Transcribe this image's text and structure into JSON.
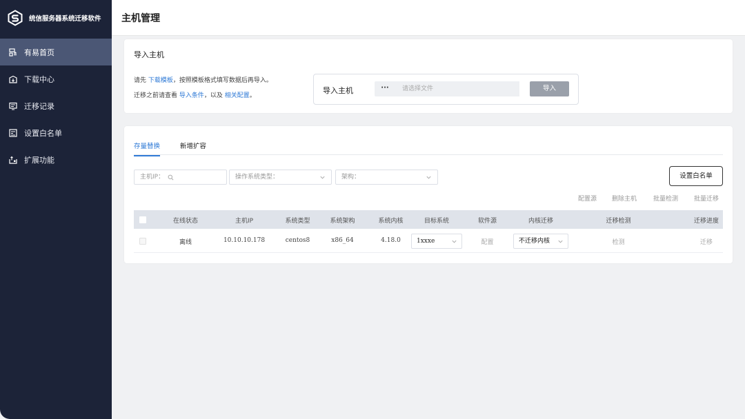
{
  "app": {
    "title": "统信服务器系统迁移软件"
  },
  "sidebar": {
    "items": [
      {
        "label": "有易首页",
        "icon": "home-icon",
        "active": true
      },
      {
        "label": "下载中心",
        "icon": "download-icon",
        "active": false
      },
      {
        "label": "迁移记录",
        "icon": "record-icon",
        "active": false
      },
      {
        "label": "设置白名单",
        "icon": "whitelist-icon",
        "active": false
      },
      {
        "label": "扩展功能",
        "icon": "extension-icon",
        "active": false
      }
    ]
  },
  "header": {
    "title": "主机管理"
  },
  "import_card": {
    "title": "导入主机",
    "hint1_prefix": "请先 ",
    "hint1_link": "下载模板",
    "hint1_suffix": "，按照模板格式填写数据后再导入。",
    "hint2_prefix": "迁移之前请查看 ",
    "hint2_link1": "导入条件",
    "hint2_mid": "，以及 ",
    "hint2_link2": "相关配置",
    "hint2_suffix": "。",
    "field_label": "导入主机",
    "browse_label": "···",
    "file_placeholder": "请选择文件",
    "import_button": "导入"
  },
  "list_card": {
    "tabs": [
      {
        "label": "存量替换",
        "active": true
      },
      {
        "label": "新增扩容",
        "active": false
      }
    ],
    "filters": {
      "ip_placeholder": "主机IP：",
      "os_placeholder": "操作系统类型：",
      "arch_placeholder": "架构："
    },
    "whitelist_button": "设置白名单",
    "actions": [
      "配置源",
      "删除主机",
      "批量检测",
      "批量迁移"
    ],
    "columns": [
      "在线状态",
      "主机IP",
      "系统类型",
      "系统架构",
      "系统内核",
      "目标系统",
      "软件源",
      "内核迁移",
      "迁移检测",
      "迁移进度"
    ],
    "rows": [
      {
        "online": "离线",
        "ip": "10.10.10.178",
        "os_type": "centos8",
        "arch": "x86_64",
        "kernel": "4.18.0",
        "target": "1xxxe",
        "source": "配置",
        "kernel_migration": "不迁移内核",
        "check": "检测",
        "progress": "迁移"
      }
    ]
  },
  "colors": {
    "sidebar_bg": "#1c2338",
    "sidebar_active": "#4b5775",
    "link": "#2f7ad6",
    "table_header": "#dfe3ea"
  }
}
